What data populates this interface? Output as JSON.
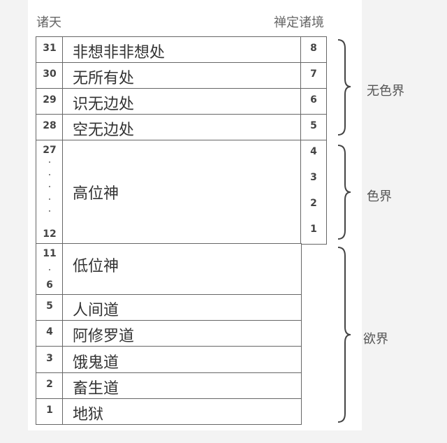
{
  "headers": {
    "heavens": "诸天",
    "meditation": "禅定诸境"
  },
  "rows": [
    {
      "num": "31",
      "name": "非想非非想处",
      "med": "8"
    },
    {
      "num": "30",
      "name": "无所有处",
      "med": "7"
    },
    {
      "num": "29",
      "name": "识无边处",
      "med": "6"
    },
    {
      "num": "28",
      "name": "空无边处",
      "med": "5"
    },
    {
      "num_top": "27",
      "num_bottom": "12",
      "name": "高位神",
      "med": [
        "4",
        "3",
        "2",
        "1"
      ]
    },
    {
      "num_top": "11",
      "num_bottom": "6",
      "name": "低位神"
    },
    {
      "num": "5",
      "name": "人间道"
    },
    {
      "num": "4",
      "name": "阿修罗道"
    },
    {
      "num": "3",
      "name": "饿鬼道"
    },
    {
      "num": "2",
      "name": "畜生道"
    },
    {
      "num": "1",
      "name": "地狱"
    }
  ],
  "realms": {
    "formless": "无色界",
    "form": "色界",
    "desire": "欲界"
  }
}
